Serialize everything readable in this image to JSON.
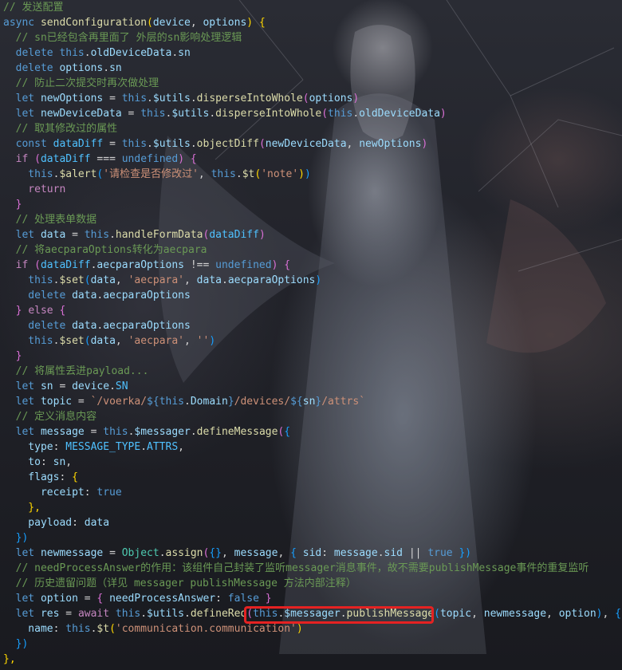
{
  "code_lines": [
    [
      {
        "t": "// 发送配置",
        "c": "cmt"
      }
    ],
    [
      {
        "t": "async ",
        "c": "kw"
      },
      {
        "t": "sendConfiguration",
        "c": "fn"
      },
      {
        "t": "(",
        "c": "brk"
      },
      {
        "t": "device",
        "c": "var"
      },
      {
        "t": ", ",
        "c": "punc"
      },
      {
        "t": "options",
        "c": "var"
      },
      {
        "t": ") ",
        "c": "brk"
      },
      {
        "t": "{",
        "c": "brk"
      }
    ],
    [
      {
        "t": "  // sn已经包含再里面了 外层的sn影响处理逻辑",
        "c": "cmt"
      }
    ],
    [
      {
        "t": "  delete ",
        "c": "kw"
      },
      {
        "t": "this",
        "c": "kw"
      },
      {
        "t": ".",
        "c": "punc"
      },
      {
        "t": "oldDeviceData",
        "c": "prop"
      },
      {
        "t": ".",
        "c": "punc"
      },
      {
        "t": "sn",
        "c": "prop"
      }
    ],
    [
      {
        "t": "  delete ",
        "c": "kw"
      },
      {
        "t": "options",
        "c": "var"
      },
      {
        "t": ".",
        "c": "punc"
      },
      {
        "t": "sn",
        "c": "prop"
      }
    ],
    [
      {
        "t": "  // 防止二次提交时再次做处理",
        "c": "cmt"
      }
    ],
    [
      {
        "t": "  let ",
        "c": "kw"
      },
      {
        "t": "newOptions",
        "c": "var"
      },
      {
        "t": " = ",
        "c": "punc"
      },
      {
        "t": "this",
        "c": "kw"
      },
      {
        "t": ".",
        "c": "punc"
      },
      {
        "t": "$utils",
        "c": "prop"
      },
      {
        "t": ".",
        "c": "punc"
      },
      {
        "t": "disperseIntoWhole",
        "c": "fn"
      },
      {
        "t": "(",
        "c": "brk2"
      },
      {
        "t": "options",
        "c": "var"
      },
      {
        "t": ")",
        "c": "brk2"
      }
    ],
    [
      {
        "t": "  let ",
        "c": "kw"
      },
      {
        "t": "newDeviceData",
        "c": "var"
      },
      {
        "t": " = ",
        "c": "punc"
      },
      {
        "t": "this",
        "c": "kw"
      },
      {
        "t": ".",
        "c": "punc"
      },
      {
        "t": "$utils",
        "c": "prop"
      },
      {
        "t": ".",
        "c": "punc"
      },
      {
        "t": "disperseIntoWhole",
        "c": "fn"
      },
      {
        "t": "(",
        "c": "brk2"
      },
      {
        "t": "this",
        "c": "kw"
      },
      {
        "t": ".",
        "c": "punc"
      },
      {
        "t": "oldDeviceData",
        "c": "prop"
      },
      {
        "t": ")",
        "c": "brk2"
      }
    ],
    [
      {
        "t": "  // 取其修改过的属性",
        "c": "cmt"
      }
    ],
    [
      {
        "t": "  const ",
        "c": "kw"
      },
      {
        "t": "dataDiff",
        "c": "const"
      },
      {
        "t": " = ",
        "c": "punc"
      },
      {
        "t": "this",
        "c": "kw"
      },
      {
        "t": ".",
        "c": "punc"
      },
      {
        "t": "$utils",
        "c": "prop"
      },
      {
        "t": ".",
        "c": "punc"
      },
      {
        "t": "objectDiff",
        "c": "fn"
      },
      {
        "t": "(",
        "c": "brk2"
      },
      {
        "t": "newDeviceData",
        "c": "var"
      },
      {
        "t": ", ",
        "c": "punc"
      },
      {
        "t": "newOptions",
        "c": "var"
      },
      {
        "t": ")",
        "c": "brk2"
      }
    ],
    [
      {
        "t": "  if ",
        "c": "ctl"
      },
      {
        "t": "(",
        "c": "brk2"
      },
      {
        "t": "dataDiff",
        "c": "const"
      },
      {
        "t": " === ",
        "c": "punc"
      },
      {
        "t": "undefined",
        "c": "kw"
      },
      {
        "t": ") ",
        "c": "brk2"
      },
      {
        "t": "{",
        "c": "brk2"
      }
    ],
    [
      {
        "t": "    this",
        "c": "kw"
      },
      {
        "t": ".",
        "c": "punc"
      },
      {
        "t": "$alert",
        "c": "fn"
      },
      {
        "t": "(",
        "c": "brk3"
      },
      {
        "t": "'请检查是否修改过'",
        "c": "str"
      },
      {
        "t": ", ",
        "c": "punc"
      },
      {
        "t": "this",
        "c": "kw"
      },
      {
        "t": ".",
        "c": "punc"
      },
      {
        "t": "$t",
        "c": "fn"
      },
      {
        "t": "(",
        "c": "brk"
      },
      {
        "t": "'note'",
        "c": "str"
      },
      {
        "t": ")",
        "c": "brk"
      },
      {
        "t": ")",
        "c": "brk3"
      }
    ],
    [
      {
        "t": "    return",
        "c": "ctl"
      }
    ],
    [
      {
        "t": "  }",
        "c": "brk2"
      }
    ],
    [
      {
        "t": "  // 处理表单数据",
        "c": "cmt"
      }
    ],
    [
      {
        "t": "  let ",
        "c": "kw"
      },
      {
        "t": "data",
        "c": "var"
      },
      {
        "t": " = ",
        "c": "punc"
      },
      {
        "t": "this",
        "c": "kw"
      },
      {
        "t": ".",
        "c": "punc"
      },
      {
        "t": "handleFormData",
        "c": "fn"
      },
      {
        "t": "(",
        "c": "brk2"
      },
      {
        "t": "dataDiff",
        "c": "const"
      },
      {
        "t": ")",
        "c": "brk2"
      }
    ],
    [
      {
        "t": "  // 将aecparaOptions转化为aecpara",
        "c": "cmt"
      }
    ],
    [
      {
        "t": "  if ",
        "c": "ctl"
      },
      {
        "t": "(",
        "c": "brk2"
      },
      {
        "t": "dataDiff",
        "c": "const"
      },
      {
        "t": ".",
        "c": "punc"
      },
      {
        "t": "aecparaOptions",
        "c": "prop"
      },
      {
        "t": " !== ",
        "c": "punc"
      },
      {
        "t": "undefined",
        "c": "kw"
      },
      {
        "t": ") ",
        "c": "brk2"
      },
      {
        "t": "{",
        "c": "brk2"
      }
    ],
    [
      {
        "t": "    this",
        "c": "kw"
      },
      {
        "t": ".",
        "c": "punc"
      },
      {
        "t": "$set",
        "c": "fn"
      },
      {
        "t": "(",
        "c": "brk3"
      },
      {
        "t": "data",
        "c": "var"
      },
      {
        "t": ", ",
        "c": "punc"
      },
      {
        "t": "'aecpara'",
        "c": "str"
      },
      {
        "t": ", ",
        "c": "punc"
      },
      {
        "t": "data",
        "c": "var"
      },
      {
        "t": ".",
        "c": "punc"
      },
      {
        "t": "aecparaOptions",
        "c": "prop"
      },
      {
        "t": ")",
        "c": "brk3"
      }
    ],
    [
      {
        "t": "    delete ",
        "c": "kw"
      },
      {
        "t": "data",
        "c": "var"
      },
      {
        "t": ".",
        "c": "punc"
      },
      {
        "t": "aecparaOptions",
        "c": "prop"
      }
    ],
    [
      {
        "t": "  } ",
        "c": "brk2"
      },
      {
        "t": "else ",
        "c": "ctl"
      },
      {
        "t": "{",
        "c": "brk2"
      }
    ],
    [
      {
        "t": "    delete ",
        "c": "kw"
      },
      {
        "t": "data",
        "c": "var"
      },
      {
        "t": ".",
        "c": "punc"
      },
      {
        "t": "aecparaOptions",
        "c": "prop"
      }
    ],
    [
      {
        "t": "    this",
        "c": "kw"
      },
      {
        "t": ".",
        "c": "punc"
      },
      {
        "t": "$set",
        "c": "fn"
      },
      {
        "t": "(",
        "c": "brk3"
      },
      {
        "t": "data",
        "c": "var"
      },
      {
        "t": ", ",
        "c": "punc"
      },
      {
        "t": "'aecpara'",
        "c": "str"
      },
      {
        "t": ", ",
        "c": "punc"
      },
      {
        "t": "''",
        "c": "str"
      },
      {
        "t": ")",
        "c": "brk3"
      }
    ],
    [
      {
        "t": "  }",
        "c": "brk2"
      }
    ],
    [
      {
        "t": "  // 将属性丢进payload...",
        "c": "cmt"
      }
    ],
    [
      {
        "t": "  let ",
        "c": "kw"
      },
      {
        "t": "sn",
        "c": "var"
      },
      {
        "t": " = ",
        "c": "punc"
      },
      {
        "t": "device",
        "c": "var"
      },
      {
        "t": ".",
        "c": "punc"
      },
      {
        "t": "SN",
        "c": "const"
      }
    ],
    [
      {
        "t": "  let ",
        "c": "kw"
      },
      {
        "t": "topic",
        "c": "var"
      },
      {
        "t": " = ",
        "c": "punc"
      },
      {
        "t": "`/voerka/",
        "c": "str"
      },
      {
        "t": "${",
        "c": "tpl-expr"
      },
      {
        "t": "this",
        "c": "kw"
      },
      {
        "t": ".",
        "c": "punc"
      },
      {
        "t": "Domain",
        "c": "prop"
      },
      {
        "t": "}",
        "c": "tpl-expr"
      },
      {
        "t": "/devices/",
        "c": "str"
      },
      {
        "t": "${",
        "c": "tpl-expr"
      },
      {
        "t": "sn",
        "c": "var"
      },
      {
        "t": "}",
        "c": "tpl-expr"
      },
      {
        "t": "/attrs`",
        "c": "str"
      }
    ],
    [
      {
        "t": "  // 定义消息内容",
        "c": "cmt"
      }
    ],
    [
      {
        "t": "  let ",
        "c": "kw"
      },
      {
        "t": "message",
        "c": "var"
      },
      {
        "t": " = ",
        "c": "punc"
      },
      {
        "t": "this",
        "c": "kw"
      },
      {
        "t": ".",
        "c": "punc"
      },
      {
        "t": "$messager",
        "c": "prop"
      },
      {
        "t": ".",
        "c": "punc"
      },
      {
        "t": "defineMessage",
        "c": "fn"
      },
      {
        "t": "(",
        "c": "brk2"
      },
      {
        "t": "{",
        "c": "brk3"
      }
    ],
    [
      {
        "t": "    type",
        "c": "prop"
      },
      {
        "t": ": ",
        "c": "punc"
      },
      {
        "t": "MESSAGE_TYPE",
        "c": "const"
      },
      {
        "t": ".",
        "c": "punc"
      },
      {
        "t": "ATTRS",
        "c": "const"
      },
      {
        "t": ",",
        "c": "punc"
      }
    ],
    [
      {
        "t": "    to",
        "c": "prop"
      },
      {
        "t": ": ",
        "c": "punc"
      },
      {
        "t": "sn",
        "c": "var"
      },
      {
        "t": ",",
        "c": "punc"
      }
    ],
    [
      {
        "t": "    flags",
        "c": "prop"
      },
      {
        "t": ": ",
        "c": "punc"
      },
      {
        "t": "{",
        "c": "brk"
      }
    ],
    [
      {
        "t": "      receipt",
        "c": "prop"
      },
      {
        "t": ": ",
        "c": "punc"
      },
      {
        "t": "true",
        "c": "kw"
      }
    ],
    [
      {
        "t": "    },",
        "c": "brk"
      }
    ],
    [
      {
        "t": "    payload",
        "c": "prop"
      },
      {
        "t": ": ",
        "c": "punc"
      },
      {
        "t": "data",
        "c": "var"
      }
    ],
    [
      {
        "t": "  })",
        "c": "brk3"
      }
    ],
    [
      {
        "t": "  let ",
        "c": "kw"
      },
      {
        "t": "newmessage",
        "c": "var"
      },
      {
        "t": " = ",
        "c": "punc"
      },
      {
        "t": "Object",
        "c": "cls"
      },
      {
        "t": ".",
        "c": "punc"
      },
      {
        "t": "assign",
        "c": "fn"
      },
      {
        "t": "(",
        "c": "brk2"
      },
      {
        "t": "{}",
        "c": "brk3"
      },
      {
        "t": ", ",
        "c": "punc"
      },
      {
        "t": "message",
        "c": "var"
      },
      {
        "t": ", ",
        "c": "punc"
      },
      {
        "t": "{ ",
        "c": "brk3"
      },
      {
        "t": "sid",
        "c": "prop"
      },
      {
        "t": ": ",
        "c": "punc"
      },
      {
        "t": "message",
        "c": "var"
      },
      {
        "t": ".",
        "c": "punc"
      },
      {
        "t": "sid",
        "c": "prop"
      },
      {
        "t": " || ",
        "c": "punc"
      },
      {
        "t": "true",
        "c": "kw"
      },
      {
        "t": " })",
        "c": "brk3"
      }
    ],
    [
      {
        "t": "  // needProcessAnswer的作用：该组件自己封装了监听messager消息事件，故不需要publishMessage事件的重复监听",
        "c": "cmt"
      }
    ],
    [
      {
        "t": "  // 历史遗留问题（详见 messager publishMessage 方法内部注释）",
        "c": "cmt"
      }
    ],
    [
      {
        "t": "  let ",
        "c": "kw"
      },
      {
        "t": "option",
        "c": "var"
      },
      {
        "t": " = ",
        "c": "punc"
      },
      {
        "t": "{ ",
        "c": "brk2"
      },
      {
        "t": "needProcessAnswer",
        "c": "prop"
      },
      {
        "t": ": ",
        "c": "punc"
      },
      {
        "t": "false",
        "c": "kw"
      },
      {
        "t": " }",
        "c": "brk2"
      }
    ],
    [
      {
        "t": "  let ",
        "c": "kw"
      },
      {
        "t": "res",
        "c": "var"
      },
      {
        "t": " = ",
        "c": "punc"
      },
      {
        "t": "await ",
        "c": "ctl"
      },
      {
        "t": "this",
        "c": "kw"
      },
      {
        "t": ".",
        "c": "punc"
      },
      {
        "t": "$utils",
        "c": "prop"
      },
      {
        "t": ".",
        "c": "punc"
      },
      {
        "t": "defineReq",
        "c": "fn"
      },
      {
        "t": "(",
        "c": "brk2"
      },
      {
        "t": "this",
        "c": "kw"
      },
      {
        "t": ".",
        "c": "punc"
      },
      {
        "t": "$messager",
        "c": "prop"
      },
      {
        "t": ".",
        "c": "punc"
      },
      {
        "t": "publishMessage",
        "c": "fn"
      },
      {
        "t": "(",
        "c": "brk3"
      },
      {
        "t": "topic",
        "c": "var"
      },
      {
        "t": ", ",
        "c": "punc"
      },
      {
        "t": "newmessage",
        "c": "var"
      },
      {
        "t": ", ",
        "c": "punc"
      },
      {
        "t": "option",
        "c": "var"
      },
      {
        "t": ")",
        "c": "brk3"
      },
      {
        "t": ", ",
        "c": "punc"
      },
      {
        "t": "{",
        "c": "brk3"
      }
    ],
    [
      {
        "t": "    name",
        "c": "prop"
      },
      {
        "t": ": ",
        "c": "punc"
      },
      {
        "t": "this",
        "c": "kw"
      },
      {
        "t": ".",
        "c": "punc"
      },
      {
        "t": "$t",
        "c": "fn"
      },
      {
        "t": "(",
        "c": "brk"
      },
      {
        "t": "'communication.communication'",
        "c": "str"
      },
      {
        "t": ")",
        "c": "brk"
      }
    ],
    [
      {
        "t": "  })",
        "c": "brk3"
      }
    ],
    [
      {
        "t": "},",
        "c": "brk"
      }
    ]
  ],
  "highlight": {
    "text": "this.$messager.publishMessage",
    "color": "#e52222"
  },
  "colors": {
    "comment": "#6a9955",
    "keyword": "#569cd6",
    "function": "#dcdcaa",
    "string": "#ce9178",
    "variable": "#9cdcfe"
  }
}
